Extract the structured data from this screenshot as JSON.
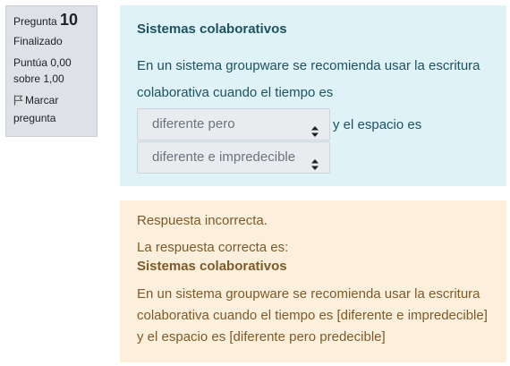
{
  "info": {
    "question_label": "Pregunta",
    "question_number": "10",
    "state": "Finalizado",
    "grade_line1": "Puntúa 0,00",
    "grade_line2": "sobre 1,00",
    "flag_line1": "Marcar",
    "flag_line2": "pregunta",
    "flag_icon": "flag-icon"
  },
  "formulation": {
    "title": "Sistemas colaborativos",
    "text_line1": "En un sistema groupware se recomienda usar la escritura",
    "text_line2": "colaborativa cuando el tiempo es",
    "select1_value": "diferente pero predecible",
    "between_text": "y el espacio es",
    "select2_value": "diferente e impredecible",
    "select_icon": "sort-arrows-icon"
  },
  "outcome": {
    "feedback": "Respuesta incorrecta.",
    "right_label": "La respuesta correcta es:",
    "right_title": "Sistemas colaborativos",
    "right_line1": "En un sistema groupware se recomienda usar la escritura",
    "right_line2": "colaborativa cuando el tiempo es [diferente e impredecible]",
    "right_line3": "y el espacio es [diferente pero predecible]"
  },
  "colors": {
    "info_bg": "#dee2e6",
    "formulation_bg": "#def2f8",
    "formulation_text": "#1e525f",
    "outcome_bg": "#fcefdc",
    "outcome_text": "#7d5a29"
  }
}
